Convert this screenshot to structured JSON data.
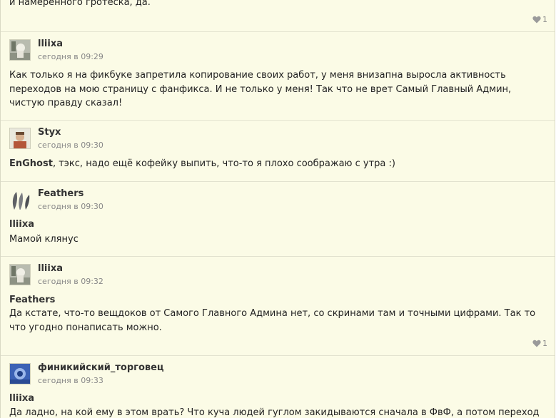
{
  "comments": [
    {
      "text": "и намеренного гротеска, да.",
      "likes": "1"
    },
    {
      "user": "lliixa",
      "time": "сегодня в 09:29",
      "text": "Как только я на фикбуке запретила копирование своих работ, у меня внизапна выросла активность переходов на мою страницу с фанфикса. И не только у меня! Так что не врет Самый Главный Админ, чистую правду сказал!"
    },
    {
      "user": "Styx",
      "time": "сегодня в 09:30",
      "mention": "EnGhost",
      "text": ", тэкс, надо ещё кофейку выпить, что-то я плохо соображаю с утра :)"
    },
    {
      "user": "Feathers",
      "time": "сегодня в 09:30",
      "mention": "lliixa",
      "text": "Мамой клянус"
    },
    {
      "user": "lliixa",
      "time": "сегодня в 09:32",
      "mention": "Feathers",
      "text": "Да кстате, что-то вещдоков от Самого Главного Админа нет, со скринами там и точными цифрами. Так то что угодно понаписать можно.",
      "likes": "1"
    },
    {
      "user": "финикийский_торговец",
      "time": "сегодня в 09:33",
      "mention": "lliixa",
      "text": "Да ладно, на кой ему в этом врать? Что куча людей гуглом закидываются сначала в ФвФ, а потом переходят"
    }
  ],
  "colors": {
    "background": "#fbfbe6",
    "divider": "#e2e2cf",
    "meta": "#888888"
  }
}
